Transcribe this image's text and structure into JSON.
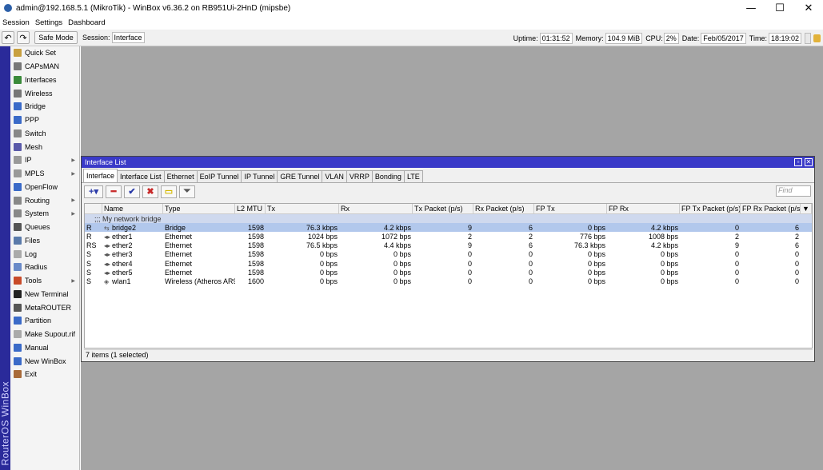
{
  "window": {
    "title": "admin@192.168.5.1 (MikroTik) - WinBox v6.36.2 on RB951Ui-2HnD (mipsbe)",
    "minimize": "—",
    "maximize": "☐",
    "close": "✕"
  },
  "menu": [
    "Session",
    "Settings",
    "Dashboard"
  ],
  "toolbar": {
    "undo": "↶",
    "redo": "↷",
    "safe_mode": "Safe Mode",
    "session_label": "Session:",
    "session_value": "Interface",
    "uptime_label": "Uptime:",
    "uptime_value": "01:31:52",
    "memory_label": "Memory:",
    "memory_value": "104.9 MiB",
    "cpu_label": "CPU:",
    "cpu_value": "2%",
    "date_label": "Date:",
    "date_value": "Feb/05/2017",
    "time_label": "Time:",
    "time_value": "18:19:02"
  },
  "sidebar": {
    "brand": "RouterOS WinBox",
    "items": [
      {
        "label": "Quick Set",
        "icon": "quickset-icon",
        "color": "#c8a040",
        "arrow": false
      },
      {
        "label": "CAPsMAN",
        "icon": "capsman-icon",
        "color": "#777777",
        "arrow": false
      },
      {
        "label": "Interfaces",
        "icon": "interfaces-icon",
        "color": "#3a8a3a",
        "arrow": false
      },
      {
        "label": "Wireless",
        "icon": "wireless-icon",
        "color": "#777777",
        "arrow": false
      },
      {
        "label": "Bridge",
        "icon": "bridge-icon",
        "color": "#3a6ac8",
        "arrow": false
      },
      {
        "label": "PPP",
        "icon": "ppp-icon",
        "color": "#3a6ac8",
        "arrow": false
      },
      {
        "label": "Switch",
        "icon": "switch-icon",
        "color": "#888888",
        "arrow": false
      },
      {
        "label": "Mesh",
        "icon": "mesh-icon",
        "color": "#5a5aaa",
        "arrow": false
      },
      {
        "label": "IP",
        "icon": "ip-icon",
        "color": "#999999",
        "arrow": true
      },
      {
        "label": "MPLS",
        "icon": "mpls-icon",
        "color": "#999999",
        "arrow": true
      },
      {
        "label": "OpenFlow",
        "icon": "openflow-icon",
        "color": "#3a6ac8",
        "arrow": false
      },
      {
        "label": "Routing",
        "icon": "routing-icon",
        "color": "#888888",
        "arrow": true
      },
      {
        "label": "System",
        "icon": "system-icon",
        "color": "#888888",
        "arrow": true
      },
      {
        "label": "Queues",
        "icon": "queues-icon",
        "color": "#555555",
        "arrow": false
      },
      {
        "label": "Files",
        "icon": "files-icon",
        "color": "#5a7aaa",
        "arrow": false
      },
      {
        "label": "Log",
        "icon": "log-icon",
        "color": "#aaaaaa",
        "arrow": false
      },
      {
        "label": "Radius",
        "icon": "radius-icon",
        "color": "#6a8ac8",
        "arrow": false
      },
      {
        "label": "Tools",
        "icon": "tools-icon",
        "color": "#c84a2a",
        "arrow": true
      },
      {
        "label": "New Terminal",
        "icon": "terminal-icon",
        "color": "#222222",
        "arrow": false
      },
      {
        "label": "MetaROUTER",
        "icon": "metarouter-icon",
        "color": "#555555",
        "arrow": false
      },
      {
        "label": "Partition",
        "icon": "partition-icon",
        "color": "#3a6ac8",
        "arrow": false
      },
      {
        "label": "Make Supout.rif",
        "icon": "supout-icon",
        "color": "#aaaaaa",
        "arrow": false
      },
      {
        "label": "Manual",
        "icon": "manual-icon",
        "color": "#3a6ac8",
        "arrow": false
      },
      {
        "label": "New WinBox",
        "icon": "winbox-icon",
        "color": "#3a6ac8",
        "arrow": false
      },
      {
        "label": "Exit",
        "icon": "exit-icon",
        "color": "#a86a3a",
        "arrow": false
      }
    ]
  },
  "iface_window": {
    "title": "Interface List",
    "tabs": [
      "Interface",
      "Interface List",
      "Ethernet",
      "EoIP Tunnel",
      "IP Tunnel",
      "GRE Tunnel",
      "VLAN",
      "VRRP",
      "Bonding",
      "LTE"
    ],
    "active_tab": "Interface",
    "find_placeholder": "Find",
    "columns": [
      "",
      "Name",
      "Type",
      "L2 MTU",
      "Tx",
      "Rx",
      "Tx Packet (p/s)",
      "Rx Packet (p/s)",
      "FP Tx",
      "FP Rx",
      "FP Tx Packet (p/s)",
      "FP Rx Packet (p/s)"
    ],
    "comment": ";;; My network bridge",
    "rows": [
      {
        "flag": "R",
        "name": "bridge2",
        "icon": "⇆",
        "type": "Bridge",
        "mtu": "1598",
        "tx": "76.3 kbps",
        "rx": "4.2 kbps",
        "txp": "9",
        "rxp": "6",
        "fptx": "0 bps",
        "fprx": "4.2 kbps",
        "fptxp": "0",
        "fprxp": "6",
        "selected": true
      },
      {
        "flag": "R",
        "name": "ether1",
        "icon": "◂▸",
        "type": "Ethernet",
        "mtu": "1598",
        "tx": "1024 bps",
        "rx": "1072 bps",
        "txp": "2",
        "rxp": "2",
        "fptx": "776 bps",
        "fprx": "1008 bps",
        "fptxp": "2",
        "fprxp": "2",
        "selected": false
      },
      {
        "flag": "RS",
        "name": "ether2",
        "icon": "◂▸",
        "type": "Ethernet",
        "mtu": "1598",
        "tx": "76.5 kbps",
        "rx": "4.4 kbps",
        "txp": "9",
        "rxp": "6",
        "fptx": "76.3 kbps",
        "fprx": "4.2 kbps",
        "fptxp": "9",
        "fprxp": "6",
        "selected": false
      },
      {
        "flag": "S",
        "name": "ether3",
        "icon": "◂▸",
        "type": "Ethernet",
        "mtu": "1598",
        "tx": "0 bps",
        "rx": "0 bps",
        "txp": "0",
        "rxp": "0",
        "fptx": "0 bps",
        "fprx": "0 bps",
        "fptxp": "0",
        "fprxp": "0",
        "selected": false
      },
      {
        "flag": "S",
        "name": "ether4",
        "icon": "◂▸",
        "type": "Ethernet",
        "mtu": "1598",
        "tx": "0 bps",
        "rx": "0 bps",
        "txp": "0",
        "rxp": "0",
        "fptx": "0 bps",
        "fprx": "0 bps",
        "fptxp": "0",
        "fprxp": "0",
        "selected": false
      },
      {
        "flag": "S",
        "name": "ether5",
        "icon": "◂▸",
        "type": "Ethernet",
        "mtu": "1598",
        "tx": "0 bps",
        "rx": "0 bps",
        "txp": "0",
        "rxp": "0",
        "fptx": "0 bps",
        "fprx": "0 bps",
        "fptxp": "0",
        "fprxp": "0",
        "selected": false
      },
      {
        "flag": "S",
        "name": "wlan1",
        "icon": "◈",
        "type": "Wireless (Atheros AR9...",
        "mtu": "1600",
        "tx": "0 bps",
        "rx": "0 bps",
        "txp": "0",
        "rxp": "0",
        "fptx": "0 bps",
        "fprx": "0 bps",
        "fptxp": "0",
        "fprxp": "0",
        "selected": false
      }
    ],
    "status": "7 items (1 selected)"
  }
}
